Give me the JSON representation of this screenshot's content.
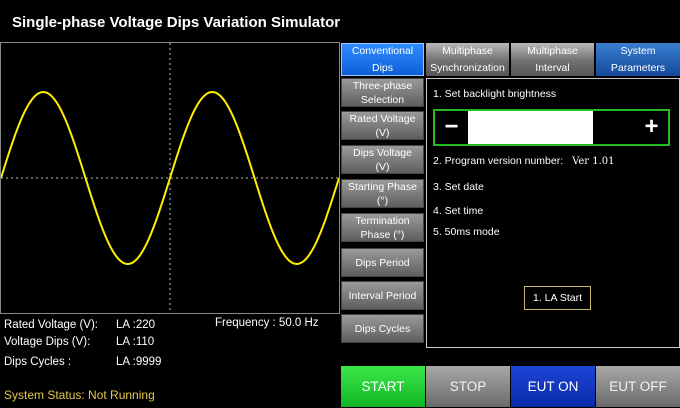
{
  "title": "Single-phase Voltage Dips Variation Simulator",
  "tabs": [
    {
      "line1": "Conventional",
      "line2": "Dips"
    },
    {
      "line1": "Multiphase",
      "line2": "Synchronization"
    },
    {
      "line1": "Multiphase",
      "line2": "Interval"
    },
    {
      "line1": "System",
      "line2": "Parameters"
    }
  ],
  "side_buttons": [
    {
      "line1": "Three-phase",
      "line2": "Selection"
    },
    {
      "line1": "Rated Voltage",
      "line2": "(V)"
    },
    {
      "line1": "Dips Voltage",
      "line2": "(V)"
    },
    {
      "line1": "Starting Phase",
      "line2": "(°)"
    },
    {
      "line1": "Termination",
      "line2": "Phase (°)"
    },
    {
      "line1": "Dips Period",
      "line2": ""
    },
    {
      "line1": "Interval Period",
      "line2": ""
    },
    {
      "line1": "Dips Cycles",
      "line2": ""
    }
  ],
  "readouts": {
    "rated_label": "Rated Voltage (V):",
    "rated_value": "LA :220",
    "dips_label": "Voltage Dips  (V):",
    "dips_value": "LA :110",
    "cycles_label": "Dips Cycles :",
    "cycles_value": "LA :9999",
    "frequency": "Frequency : 50.0 Hz"
  },
  "status": "System Status: Not Running",
  "panel": {
    "item1": "1. Set backlight brightness",
    "item2_label": "2. Program version number:",
    "item2_value": "Ver 1.01",
    "item3": "3. Set date",
    "item4": "4. Set time",
    "item5": "5. 50ms mode",
    "brightness_fraction": 0.75,
    "minus": "−",
    "plus": "+",
    "la_start": "1. LA Start"
  },
  "buttons": {
    "start": "START",
    "stop": "STOP",
    "eut_on": "EUT ON",
    "eut_off": "EUT OFF"
  },
  "colors": {
    "waveform": "#ffee00",
    "status": "#e6c84a",
    "start": "#22cc33",
    "eut_on": "#1133cc",
    "brightness_border": "#22bb22"
  }
}
